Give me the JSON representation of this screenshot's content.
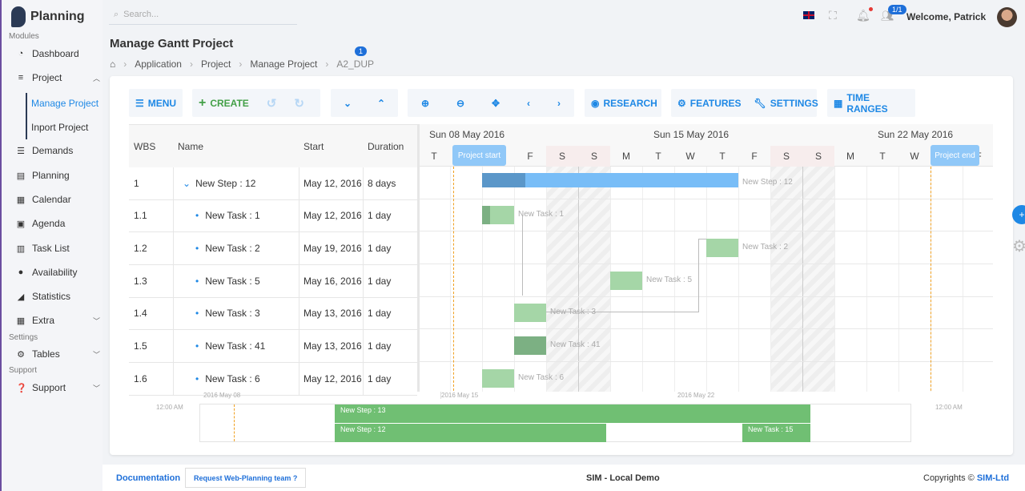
{
  "app": {
    "title": "Planning"
  },
  "sidebar": {
    "sections": [
      "Modules",
      "Settings",
      "Support"
    ],
    "items": [
      {
        "label": "Dashboard",
        "icon": "dashboard-icon"
      },
      {
        "label": "Project",
        "icon": "sort-icon",
        "expanded": true
      },
      {
        "label": "Demands",
        "icon": "list-icon"
      },
      {
        "label": "Planning",
        "icon": "gantt-icon"
      },
      {
        "label": "Calendar",
        "icon": "calendar-icon"
      },
      {
        "label": "Agenda",
        "icon": "agenda-icon"
      },
      {
        "label": "Task List",
        "icon": "table-icon"
      },
      {
        "label": "Availability",
        "icon": "user-search-icon"
      },
      {
        "label": "Statistics",
        "icon": "chart-icon"
      },
      {
        "label": "Extra",
        "icon": "grid-icon"
      },
      {
        "label": "Tables",
        "icon": "gear-icon"
      },
      {
        "label": "Support",
        "icon": "help-icon"
      }
    ],
    "project_sub": [
      "Manage Project",
      "Inport Project"
    ]
  },
  "header": {
    "search_placeholder": "Search...",
    "users_badge": "1/1",
    "welcome": "Welcome, Patrick"
  },
  "page": {
    "title": "Manage Gantt Project",
    "breadcrumb": [
      "Application",
      "Project",
      "Manage Project",
      "A2_DUP"
    ],
    "breadcrumb_badge": "1"
  },
  "toolbar": {
    "menu": "MENU",
    "create": "CREATE",
    "research": "RESEARCH",
    "features": "FEATURES",
    "settings": "SETTINGS",
    "time_ranges": "TIME RANGES"
  },
  "grid": {
    "columns": [
      "WBS",
      "Name",
      "Start",
      "Duration"
    ],
    "rows": [
      {
        "wbs": "1",
        "name": "New Step : 12",
        "start": "May 12, 2016",
        "duration": "8 days",
        "type": "project",
        "date": "2016-05-12",
        "days": 8,
        "progress": 0.17
      },
      {
        "wbs": "1.1",
        "name": "New Task : 1",
        "start": "May 12, 2016",
        "duration": "1 day",
        "type": "task",
        "date": "2016-05-12",
        "days": 1,
        "progress": 0.25
      },
      {
        "wbs": "1.2",
        "name": "New Task : 2",
        "start": "May 19, 2016",
        "duration": "1 day",
        "type": "task",
        "date": "2016-05-19",
        "days": 1,
        "progress": 0
      },
      {
        "wbs": "1.3",
        "name": "New Task : 5",
        "start": "May 16, 2016",
        "duration": "1 day",
        "type": "task",
        "date": "2016-05-16",
        "days": 1,
        "progress": 0
      },
      {
        "wbs": "1.4",
        "name": "New Task : 3",
        "start": "May 13, 2016",
        "duration": "1 day",
        "type": "task",
        "date": "2016-05-13",
        "days": 1,
        "progress": 0
      },
      {
        "wbs": "1.5",
        "name": "New Task : 41",
        "start": "May 13, 2016",
        "duration": "1 day",
        "type": "task",
        "date": "2016-05-13",
        "days": 1,
        "progress": 1
      },
      {
        "wbs": "1.6",
        "name": "New Task : 6",
        "start": "May 12, 2016",
        "duration": "1 day",
        "type": "task",
        "date": "2016-05-12",
        "days": 1,
        "progress": 0
      }
    ]
  },
  "timeline": {
    "weeks": [
      "Sun 08 May 2016",
      "Sun 15 May 2016",
      "Sun 22 May 2016"
    ],
    "days": [
      "T",
      "W",
      "T",
      "F",
      "S",
      "S",
      "M",
      "T",
      "W",
      "T",
      "F",
      "S",
      "S",
      "M",
      "T",
      "W",
      "T",
      "F"
    ],
    "project_start": "Project start",
    "project_end": "Project end"
  },
  "mini": {
    "ticks": [
      "2016 May 08",
      "2016 May 15",
      "2016 May 22"
    ],
    "time_left": "12:00 AM",
    "time_right": "12:00 AM",
    "bars": [
      "New Step : 13",
      "New Step : 12",
      "New Task : 15"
    ]
  },
  "footer": {
    "documentation": "Documentation",
    "request": "Request Web-Planning team ?",
    "center": "SIM - Local Demo",
    "copyright": "Copyrights ©",
    "company": "SIM-Ltd"
  },
  "colors": {
    "accent": "#1e88e5",
    "task": "#a5d6a7",
    "task_progress": "#7cb083",
    "project": "#78bdf7",
    "project_progress": "#5b97c9",
    "mini": "#70bf73"
  }
}
